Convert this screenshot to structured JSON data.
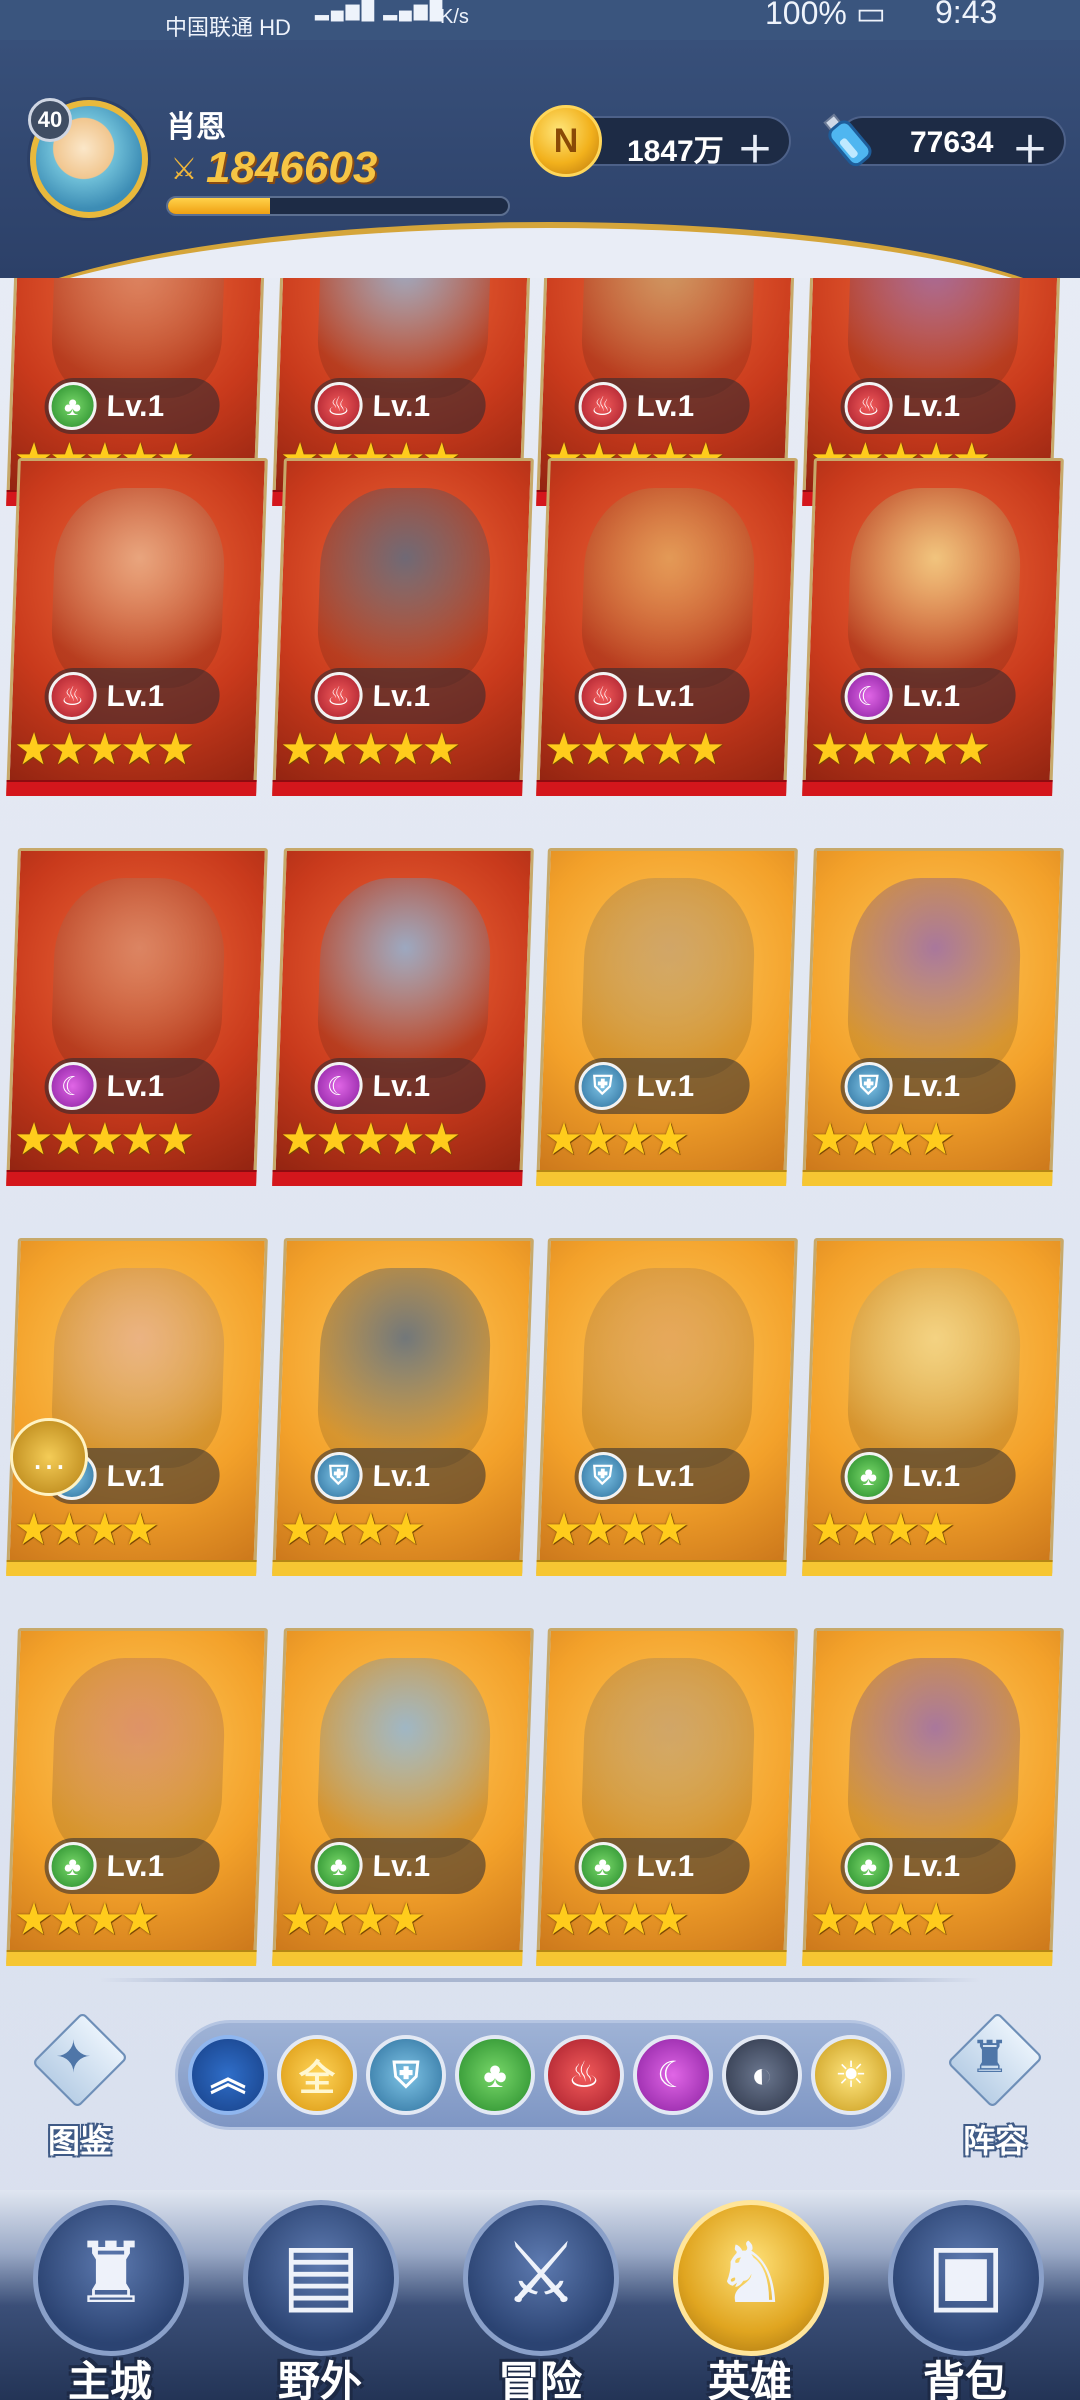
{
  "status_bar": {
    "carrier": "中国联通 HD",
    "speed_unit": "K/s",
    "battery": "100%",
    "time": "9:43"
  },
  "player": {
    "level": "40",
    "name": "肖恩",
    "power": "1846603",
    "xp_fraction": 0.3
  },
  "resources": {
    "coins": "1847万",
    "potions": "77634",
    "coin_icon": "coin-icon",
    "potion_icon": "potion-icon"
  },
  "heroes": [
    {
      "level": "Lv.1",
      "stars": 5,
      "element": "nature",
      "frame": "red"
    },
    {
      "level": "Lv.1",
      "stars": 5,
      "element": "fire",
      "frame": "red"
    },
    {
      "level": "Lv.1",
      "stars": 5,
      "element": "fire",
      "frame": "red"
    },
    {
      "level": "Lv.1",
      "stars": 5,
      "element": "fire",
      "frame": "red"
    },
    {
      "level": "Lv.1",
      "stars": 5,
      "element": "fire",
      "frame": "red"
    },
    {
      "level": "Lv.1",
      "stars": 5,
      "element": "fire",
      "frame": "red"
    },
    {
      "level": "Lv.1",
      "stars": 5,
      "element": "fire",
      "frame": "red"
    },
    {
      "level": "Lv.1",
      "stars": 5,
      "element": "dark",
      "frame": "red"
    },
    {
      "level": "Lv.1",
      "stars": 5,
      "element": "dark",
      "frame": "red"
    },
    {
      "level": "Lv.1",
      "stars": 5,
      "element": "dark",
      "frame": "red"
    },
    {
      "level": "Lv.1",
      "stars": 4,
      "element": "steel",
      "frame": "gold"
    },
    {
      "level": "Lv.1",
      "stars": 4,
      "element": "steel",
      "frame": "gold"
    },
    {
      "level": "Lv.1",
      "stars": 4,
      "element": "steel",
      "frame": "gold"
    },
    {
      "level": "Lv.1",
      "stars": 4,
      "element": "steel",
      "frame": "gold"
    },
    {
      "level": "Lv.1",
      "stars": 4,
      "element": "steel",
      "frame": "gold"
    },
    {
      "level": "Lv.1",
      "stars": 4,
      "element": "nature",
      "frame": "gold"
    },
    {
      "level": "Lv.1",
      "stars": 4,
      "element": "nature",
      "frame": "gold"
    },
    {
      "level": "Lv.1",
      "stars": 4,
      "element": "nature",
      "frame": "gold"
    },
    {
      "level": "Lv.1",
      "stars": 4,
      "element": "nature",
      "frame": "gold"
    },
    {
      "level": "Lv.1",
      "stars": 4,
      "element": "nature",
      "frame": "gold"
    }
  ],
  "side_buttons": {
    "codex": "图鉴",
    "lineup": "阵容"
  },
  "filters": [
    {
      "id": "collapse",
      "glyph": "︽"
    },
    {
      "id": "all",
      "glyph": "全"
    },
    {
      "id": "steel",
      "glyph": "⛨"
    },
    {
      "id": "nature",
      "glyph": "♣"
    },
    {
      "id": "fire",
      "glyph": "♨"
    },
    {
      "id": "dark",
      "glyph": "☾"
    },
    {
      "id": "shadow",
      "glyph": "◐"
    },
    {
      "id": "light",
      "glyph": "☀"
    }
  ],
  "nav": [
    {
      "label": "主城",
      "glyph": "♜",
      "active": false
    },
    {
      "label": "野外",
      "glyph": "▤",
      "active": false
    },
    {
      "label": "冒险",
      "glyph": "⚔",
      "active": false
    },
    {
      "label": "英雄",
      "glyph": "♞",
      "active": true
    },
    {
      "label": "背包",
      "glyph": "▣",
      "active": false
    }
  ],
  "colors": {
    "header": "#2c4068",
    "gold": "#f6c545",
    "red_frame": "#d4161c",
    "gold_frame": "#f6c632"
  }
}
